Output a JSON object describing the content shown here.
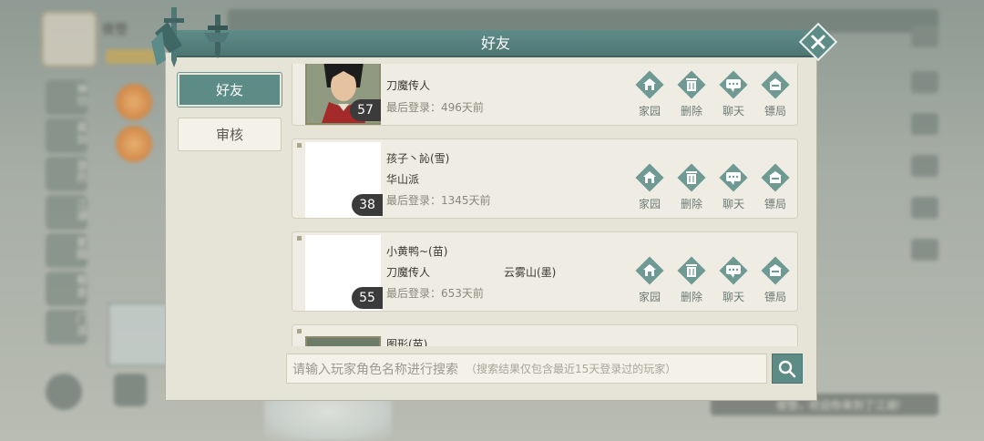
{
  "background": {
    "player_name": "夜箜",
    "side_menu": [
      "神功",
      "英剑",
      "游历",
      "江湖",
      "家园",
      "帮会",
      "门派"
    ],
    "chat_text": "夜箜，欢迎你来到了江湖!"
  },
  "dialog": {
    "title": "好友",
    "tabs": [
      {
        "label": "好友",
        "active": true
      },
      {
        "label": "审核",
        "active": false
      }
    ],
    "actions": [
      "家园",
      "删除",
      "聊天",
      "镖局"
    ],
    "friends": [
      {
        "name": "",
        "sect": "刀魔传人",
        "guild": "",
        "last_login": "最后登录：496天前",
        "level": "57",
        "avatar": "framed"
      },
      {
        "name": "孩子丶訫(雪)",
        "sect": "华山派",
        "guild": "",
        "last_login": "最后登录：1345天前",
        "level": "38",
        "avatar": "blank"
      },
      {
        "name": "小黄鸭~(苗)",
        "sect": "刀魔传人",
        "guild": "云雾山(墨)",
        "last_login": "最后登录：653天前",
        "level": "55",
        "avatar": "blank"
      },
      {
        "name": "图形(苗)",
        "sect": "",
        "guild": "",
        "last_login": "",
        "level": "",
        "avatar": "framed"
      }
    ],
    "search": {
      "placeholder": "请输入玩家角色名称进行搜索",
      "hint": "（搜索结果仅包含最近15天登录过的玩家）"
    }
  },
  "colors": {
    "accent": "#5d8b86",
    "panel": "#e6e3d7",
    "row": "#efede3"
  }
}
